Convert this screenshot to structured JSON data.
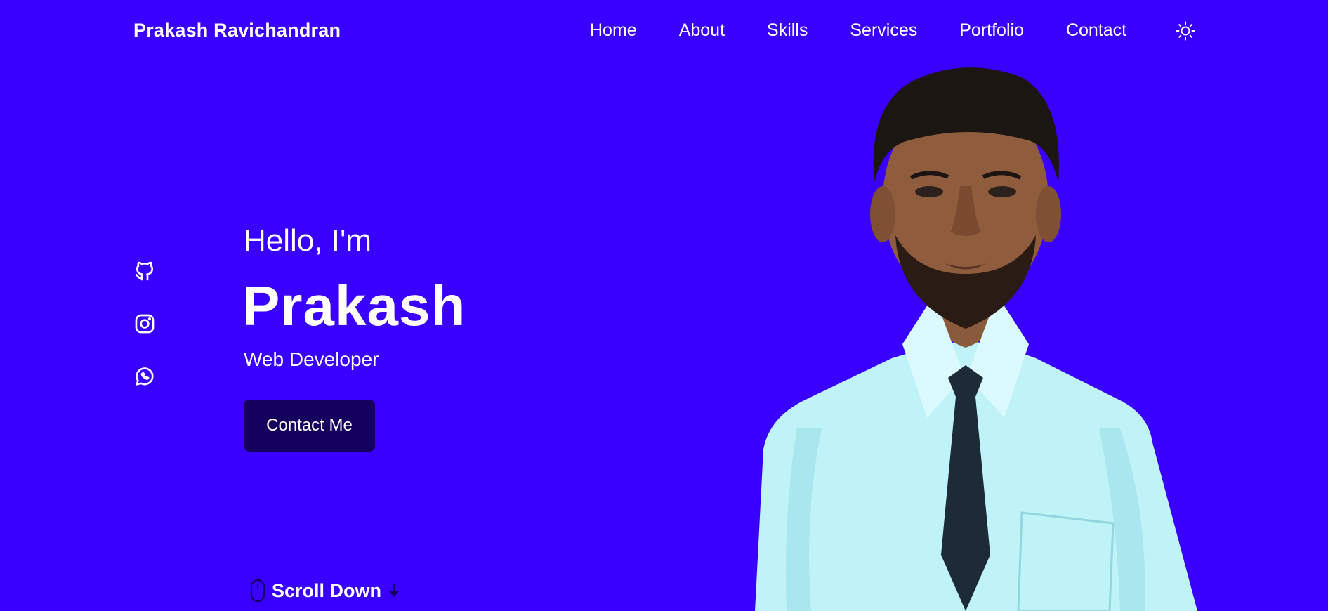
{
  "header": {
    "logo": "Prakash Ravichandran",
    "nav": [
      {
        "label": "Home"
      },
      {
        "label": "About"
      },
      {
        "label": "Skills"
      },
      {
        "label": "Services"
      },
      {
        "label": "Portfolio"
      },
      {
        "label": "Contact"
      }
    ],
    "theme_icon": "sun-icon"
  },
  "social": [
    {
      "icon": "github-icon"
    },
    {
      "icon": "instagram-icon"
    },
    {
      "icon": "whatsapp-icon"
    }
  ],
  "hero": {
    "greeting": "Hello, I'm",
    "name": "Prakash",
    "role": "Web Developer",
    "cta": "Contact Me",
    "scroll": "Scroll Down"
  },
  "colors": {
    "background": "#3a00ff",
    "button": "#16005e",
    "text": "#ffffff"
  }
}
